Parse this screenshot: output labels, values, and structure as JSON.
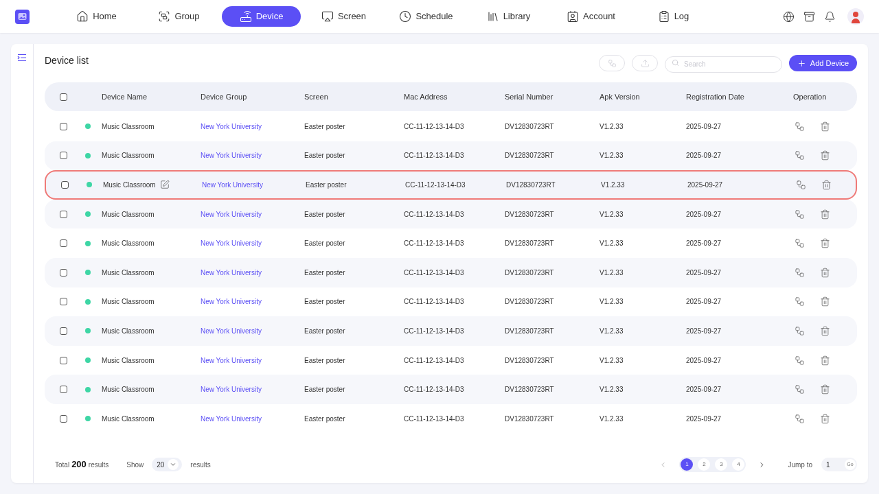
{
  "nav": {
    "items": [
      {
        "label": "Home",
        "selected": false
      },
      {
        "label": "Group",
        "selected": false
      },
      {
        "label": "Device",
        "selected": true
      },
      {
        "label": "Screen",
        "selected": false
      },
      {
        "label": "Schedule",
        "selected": false
      },
      {
        "label": "Library",
        "selected": false
      },
      {
        "label": "Account",
        "selected": false
      },
      {
        "label": "Log",
        "selected": false
      }
    ]
  },
  "page": {
    "title": "Device list",
    "search": {
      "placeholder": "Search"
    },
    "add_button": "Add Device"
  },
  "table": {
    "all_checked": false,
    "columns": [
      "Device Name",
      "Device Group",
      "Screen",
      "Mac Address",
      "Serial Number",
      "Apk Version",
      "Registration Date",
      "Operation"
    ],
    "rows": [
      {
        "checked": false,
        "color": "#3ed6a5",
        "name": "Music Classroom",
        "group": "New York University",
        "screen": "Easter poster",
        "mac": "CC-11-12-13-14-D3",
        "serial": "DV12830723RT",
        "apk": "V1.2.33",
        "date": "2025-09-27",
        "selected": false
      },
      {
        "checked": false,
        "color": "#3ed6a5",
        "name": "Music Classroom",
        "group": "New York University",
        "screen": "Easter poster",
        "mac": "CC-11-12-13-14-D3",
        "serial": "DV12830723RT",
        "apk": "V1.2.33",
        "date": "2025-09-27",
        "selected": false
      },
      {
        "checked": false,
        "color": "#3ed6a5",
        "name": "Music Classroom",
        "group": "New York University",
        "screen": "Easter poster",
        "mac": "CC-11-12-13-14-D3",
        "serial": "DV12830723RT",
        "apk": "V1.2.33",
        "date": "2025-09-27",
        "selected": true
      },
      {
        "checked": false,
        "color": "#3ed6a5",
        "name": "Music Classroom",
        "group": "New York University",
        "screen": "Easter poster",
        "mac": "CC-11-12-13-14-D3",
        "serial": "DV12830723RT",
        "apk": "V1.2.33",
        "date": "2025-09-27",
        "selected": false
      },
      {
        "checked": false,
        "color": "#3ed6a5",
        "name": "Music Classroom",
        "group": "New York University",
        "screen": "Easter poster",
        "mac": "CC-11-12-13-14-D3",
        "serial": "DV12830723RT",
        "apk": "V1.2.33",
        "date": "2025-09-27",
        "selected": false
      },
      {
        "checked": false,
        "color": "#3ed6a5",
        "name": "Music Classroom",
        "group": "New York University",
        "screen": "Easter poster",
        "mac": "CC-11-12-13-14-D3",
        "serial": "DV12830723RT",
        "apk": "V1.2.33",
        "date": "2025-09-27",
        "selected": false
      },
      {
        "checked": false,
        "color": "#3ed6a5",
        "name": "Music Classroom",
        "group": "New York University",
        "screen": "Easter poster",
        "mac": "CC-11-12-13-14-D3",
        "serial": "DV12830723RT",
        "apk": "V1.2.33",
        "date": "2025-09-27",
        "selected": false
      },
      {
        "checked": false,
        "color": "#3ed6a5",
        "name": "Music Classroom",
        "group": "New York University",
        "screen": "Easter poster",
        "mac": "CC-11-12-13-14-D3",
        "serial": "DV12830723RT",
        "apk": "V1.2.33",
        "date": "2025-09-27",
        "selected": false
      },
      {
        "checked": false,
        "color": "#3ed6a5",
        "name": "Music Classroom",
        "group": "New York University",
        "screen": "Easter poster",
        "mac": "CC-11-12-13-14-D3",
        "serial": "DV12830723RT",
        "apk": "V1.2.33",
        "date": "2025-09-27",
        "selected": false
      },
      {
        "checked": false,
        "color": "#3ed6a5",
        "name": "Music Classroom",
        "group": "New York University",
        "screen": "Easter poster",
        "mac": "CC-11-12-13-14-D3",
        "serial": "DV12830723RT",
        "apk": "V1.2.33",
        "date": "2025-09-27",
        "selected": false
      },
      {
        "checked": false,
        "color": "#3ed6a5",
        "name": "Music Classroom",
        "group": "New York University",
        "screen": "Easter poster",
        "mac": "CC-11-12-13-14-D3",
        "serial": "DV12830723RT",
        "apk": "V1.2.33",
        "date": "2025-09-27",
        "selected": false
      }
    ]
  },
  "footer": {
    "total_prefix": "Total",
    "total": "200",
    "total_suffix": "results",
    "show_label": "Show",
    "page_size": "20",
    "show_suffix": "results",
    "pages": [
      {
        "label": "1",
        "selected": true
      },
      {
        "label": "2",
        "selected": false
      },
      {
        "label": "3",
        "selected": false
      },
      {
        "label": "4",
        "selected": false
      }
    ],
    "jump_label": "Jump to",
    "jump_value": "1",
    "go": "Go"
  }
}
